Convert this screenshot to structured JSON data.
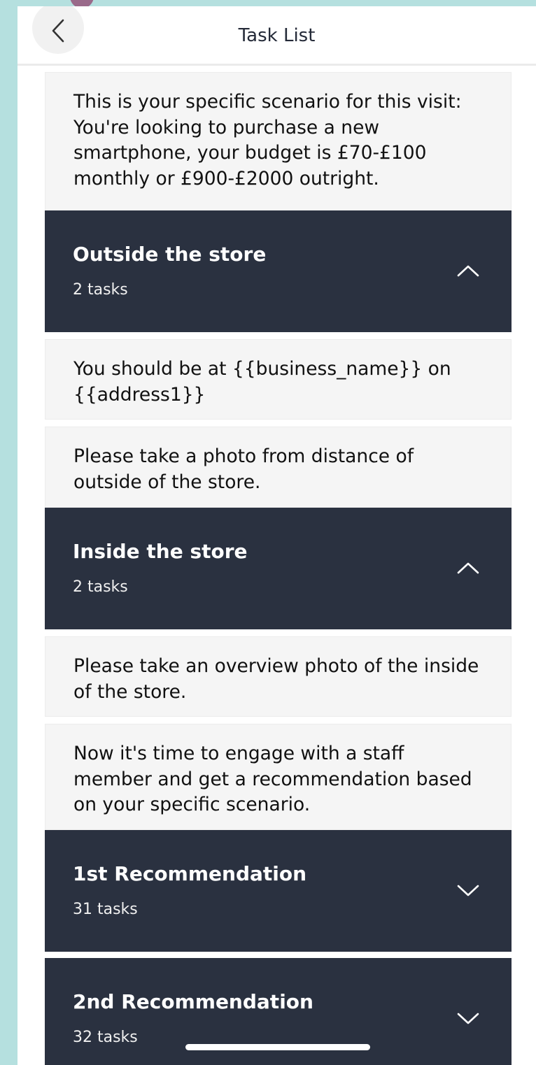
{
  "header": {
    "title": "Task List",
    "back_icon": "chevron-left-icon"
  },
  "scenario_text": "This is your specific scenario for this visit: You're looking to purchase a new smartphone, your budget is £70-£100 monthly or £900-£2000 outright.",
  "sections": [
    {
      "title": "Outside the store",
      "count": "2 tasks",
      "expanded": true,
      "chevron_icon": "chevron-up-icon",
      "tasks": [
        "You should be at {{business_name}} on {{address1}}",
        "Please take a photo from distance of outside of the store."
      ]
    },
    {
      "title": "Inside the store",
      "count": "2 tasks",
      "expanded": true,
      "chevron_icon": "chevron-up-icon",
      "tasks": [
        "Please take an overview photo of the inside of the store.",
        "Now it's time to engage with a staff member and get a recommendation based on your specific scenario."
      ]
    },
    {
      "title": "1st Recommendation",
      "count": "31 tasks",
      "expanded": false,
      "chevron_icon": "chevron-down-icon"
    },
    {
      "title": "2nd Recommendation",
      "count": "32 tasks",
      "expanded": false,
      "chevron_icon": "chevron-down-icon"
    }
  ],
  "colors": {
    "section_bg": "#2a3140",
    "note_bg": "#f5f5f5",
    "frame_bg": "#b5e0df",
    "title_text": "#242a38"
  }
}
